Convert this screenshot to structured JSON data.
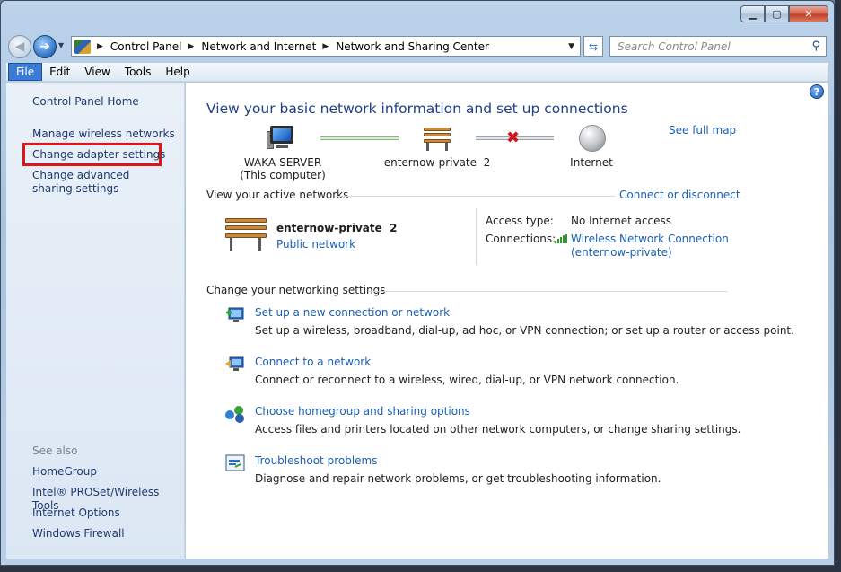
{
  "window": {
    "caption_min": "▁",
    "caption_max": "▢",
    "caption_close": "✕"
  },
  "address_bar": {
    "crumbs": [
      "Control Panel",
      "Network and Internet",
      "Network and Sharing Center"
    ],
    "separator": "▶",
    "search_placeholder": "Search Control Panel"
  },
  "menu": {
    "items": [
      "File",
      "Edit",
      "View",
      "Tools",
      "Help"
    ]
  },
  "sidebar": {
    "links": [
      "Control Panel Home",
      "Manage wireless networks",
      "Change adapter settings",
      "Change advanced sharing settings"
    ],
    "see_also_heading": "See also",
    "see_also": [
      "HomeGroup",
      "Intel® PROSet/Wireless Tools",
      "Internet Options",
      "Windows Firewall"
    ]
  },
  "main": {
    "title": "View your basic network information and set up connections",
    "see_full_map": "See full map",
    "map": {
      "computer_name": "WAKA-SERVER",
      "computer_sub": "(This computer)",
      "network_name": "enternow-private  2",
      "internet": "Internet"
    },
    "active_networks_label": "View your active networks",
    "connect_or_disconnect": "Connect or disconnect",
    "active_network": {
      "name": "enternow-private  2",
      "type": "Public network",
      "access_type_label": "Access type:",
      "access_type_value": "No Internet access",
      "connections_label": "Connections:",
      "connection_line1": "Wireless Network Connection",
      "connection_line2": "(enternow-private)"
    },
    "change_settings_label": "Change your networking settings",
    "tasks": [
      {
        "title": "Set up a new connection or network",
        "desc": "Set up a wireless, broadband, dial-up, ad hoc, or VPN connection; or set up a router or access point."
      },
      {
        "title": "Connect to a network",
        "desc": "Connect or reconnect to a wireless, wired, dial-up, or VPN network connection."
      },
      {
        "title": "Choose homegroup and sharing options",
        "desc": "Access files and printers located on other network computers, or change sharing settings."
      },
      {
        "title": "Troubleshoot problems",
        "desc": "Diagnose and repair network problems, or get troubleshooting information."
      }
    ]
  }
}
